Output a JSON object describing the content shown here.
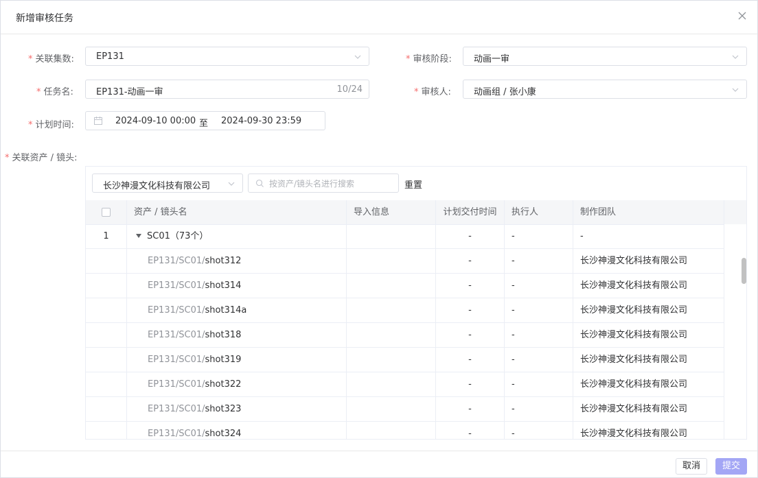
{
  "dialog": {
    "title": "新增审核任务"
  },
  "form": {
    "required_mark": "*",
    "episode_label": "关联集数:",
    "episode_value": "EP131",
    "stage_label": "审核阶段:",
    "stage_value": "动画一审",
    "task_name_label": "任务名:",
    "task_name_value": "EP131-动画一审",
    "task_name_count": "10/24",
    "reviewer_label": "审核人:",
    "reviewer_value": "动画组 / 张小康",
    "plan_time_label": "计划时间:",
    "plan_start": "2024-09-10 00:00",
    "plan_separator": "至",
    "plan_end": "2024-09-30 23:59",
    "assets_label": "关联资产 / 镜头:"
  },
  "assets_panel": {
    "company_value": "长沙神漫文化科技有限公司",
    "search_placeholder": "按资产/镜头名进行搜索",
    "reset_label": "重置",
    "columns": [
      "资产 / 镜头名",
      "导入信息",
      "计划交付时间",
      "执行人",
      "制作团队"
    ],
    "group": {
      "index": "1",
      "label": "SC01（73个）",
      "due": "-",
      "assignee": "-",
      "team": "-"
    },
    "rows": [
      {
        "path": "EP131/SC01/",
        "shot": "shot312",
        "due": "-",
        "assignee": "-",
        "team": "长沙神漫文化科技有限公司"
      },
      {
        "path": "EP131/SC01/",
        "shot": "shot314",
        "due": "-",
        "assignee": "-",
        "team": "长沙神漫文化科技有限公司"
      },
      {
        "path": "EP131/SC01/",
        "shot": "shot314a",
        "due": "-",
        "assignee": "-",
        "team": "长沙神漫文化科技有限公司"
      },
      {
        "path": "EP131/SC01/",
        "shot": "shot318",
        "due": "-",
        "assignee": "-",
        "team": "长沙神漫文化科技有限公司"
      },
      {
        "path": "EP131/SC01/",
        "shot": "shot319",
        "due": "-",
        "assignee": "-",
        "team": "长沙神漫文化科技有限公司"
      },
      {
        "path": "EP131/SC01/",
        "shot": "shot322",
        "due": "-",
        "assignee": "-",
        "team": "长沙神漫文化科技有限公司"
      },
      {
        "path": "EP131/SC01/",
        "shot": "shot323",
        "due": "-",
        "assignee": "-",
        "team": "长沙神漫文化科技有限公司"
      },
      {
        "path": "EP131/SC01/",
        "shot": "shot324",
        "due": "-",
        "assignee": "-",
        "team": "长沙神漫文化科技有限公司"
      }
    ]
  },
  "footer": {
    "cancel_label": "取消",
    "submit_label": "提交"
  },
  "colors": {
    "accent_disabled": "#a3a6f5",
    "required": "#f56c6c"
  },
  "icons": [
    "close-icon",
    "chevron-down-icon",
    "calendar-icon",
    "search-icon",
    "caret-down-icon"
  ]
}
